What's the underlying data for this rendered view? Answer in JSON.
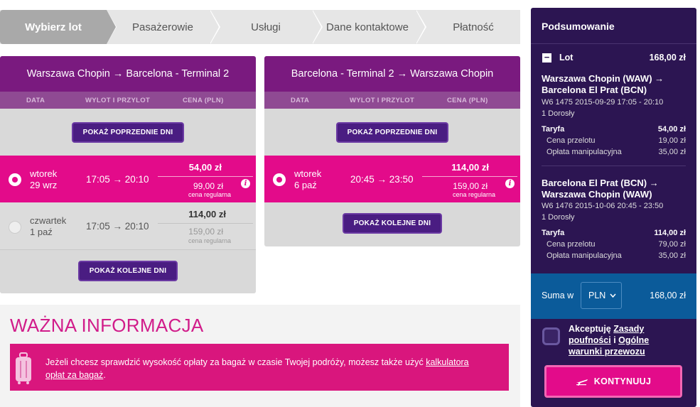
{
  "steps": [
    "Wybierz lot",
    "Pasażerowie",
    "Usługi",
    "Dane kontaktowe",
    "Płatność"
  ],
  "columns": {
    "date": "DATA",
    "time": "WYLOT I PRZYLOT",
    "price": "CENA (PLN)"
  },
  "outbound": {
    "title": "Warszawa Chopin → Barcelona - Terminal 2",
    "prev_btn": "POKAŻ POPRZEDNIE DNI",
    "next_btn": "POKAŻ KOLEJNE DNI",
    "rows": [
      {
        "day": "wtorek",
        "date": "29 wrz",
        "times": "17:05 → 20:10",
        "price": "54,00 zł",
        "reg_price": "99,00 zł",
        "reg_label": "cena regularna",
        "selected": true
      },
      {
        "day": "czwartek",
        "date": "1 paź",
        "times": "17:05 → 20:10",
        "price": "114,00 zł",
        "reg_price": "159,00 zł",
        "reg_label": "cena regularna",
        "selected": false
      }
    ]
  },
  "inbound": {
    "title": "Barcelona - Terminal 2 → Warszawa Chopin",
    "prev_btn": "POKAŻ POPRZEDNIE DNI",
    "next_btn": "POKAŻ KOLEJNE DNI",
    "rows": [
      {
        "day": "wtorek",
        "date": "6 paź",
        "times": "20:45 → 23:50",
        "price": "114,00 zł",
        "reg_price": "159,00 zł",
        "reg_label": "cena regularna",
        "selected": true
      }
    ]
  },
  "info": {
    "heading": "WAŻNA INFORMACJA",
    "text": "Jeżeli chcesz sprawdzić wysokość opłaty za bagaż w czasie Twojej podróży, możesz także użyć",
    "link1": "kalkulatora",
    "link2": "opłat za bagaż",
    "dot": "."
  },
  "summary": {
    "title": "Podsumowanie",
    "lot_label": "Lot",
    "lot_total": "168,00 zł",
    "flights": [
      {
        "route1": "Warszawa Chopin (WAW) →",
        "route2": "Barcelona El Prat (BCN)",
        "detail": "W6 1475  2015-09-29 17:05 - 20:10",
        "pax": "1 Dorosły",
        "fare_label": "Taryfa",
        "fare": "54,00 zł",
        "base_label": "Cena przelotu",
        "base": "19,00 zł",
        "fee_label": "Opłata manipulacyjna",
        "fee": "35,00 zł"
      },
      {
        "route1": "Barcelona El Prat (BCN) →",
        "route2": "Warszawa Chopin (WAW)",
        "detail": "W6 1476  2015-10-06 20:45 - 23:50",
        "pax": "1 Dorosły",
        "fare_label": "Taryfa",
        "fare": "114,00 zł",
        "base_label": "Cena przelotu",
        "base": "79,00 zł",
        "fee_label": "Opłata manipulacyjna",
        "fee": "35,00 zł"
      }
    ],
    "sum_label": "Suma w",
    "currency": "PLN",
    "sum_total": "168,00 zł",
    "accept_prefix": "Akceptuję",
    "accept_link1": "Zasady",
    "accept_link1b": "poufności",
    "accept_and": "i",
    "accept_link2": "Ogólne",
    "accept_link2b": "warunki przewozu",
    "continue_btn": "KONTYNUUJ"
  },
  "colors": {
    "brand_purple": "#7a1a7f",
    "brand_pink": "#e30b8a",
    "summary_bg": "#2c1552",
    "total_bg": "#0b5b9a"
  }
}
